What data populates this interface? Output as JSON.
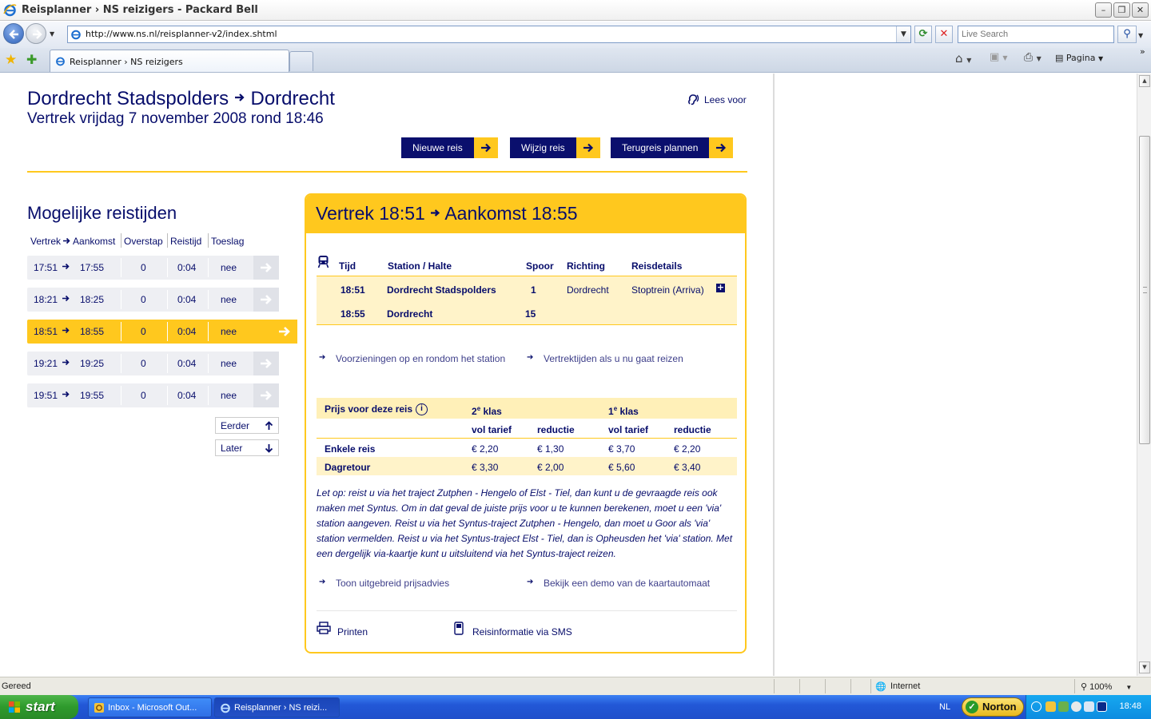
{
  "window": {
    "title": "Reisplanner › NS reizigers - Packard Bell",
    "minimize": "–",
    "maximize": "❐",
    "close": "✕"
  },
  "address": {
    "url": "http://www.ns.nl/reisplanner-v2/index.shtml",
    "search_placeholder": "Live Search"
  },
  "tabs": [
    {
      "title": "Reisplanner › NS reizigers"
    }
  ],
  "toolbar": {
    "page_label": "Pagina"
  },
  "page": {
    "route_from": "Dordrecht Stadspolders",
    "route_to": "Dordrecht",
    "date_line": "Vertrek vrijdag 7 november 2008 rond 18:46",
    "read_aloud": "Lees voor",
    "buttons": {
      "new": "Nieuwe reis",
      "edit": "Wijzig reis",
      "return": "Terugreis plannen"
    },
    "options_title": "Mogelijke reistijden",
    "columns": {
      "depart_arrive": "Vertrek",
      "arrive": "Aankomst",
      "transfers": "Overstap",
      "duration": "Reistijd",
      "surcharge": "Toeslag"
    },
    "trips": [
      {
        "dep": "17:51",
        "arr": "17:55",
        "transfers": "0",
        "duration": "0:04",
        "surcharge": "nee",
        "selected": false
      },
      {
        "dep": "18:21",
        "arr": "18:25",
        "transfers": "0",
        "duration": "0:04",
        "surcharge": "nee",
        "selected": false
      },
      {
        "dep": "18:51",
        "arr": "18:55",
        "transfers": "0",
        "duration": "0:04",
        "surcharge": "nee",
        "selected": true
      },
      {
        "dep": "19:21",
        "arr": "19:25",
        "transfers": "0",
        "duration": "0:04",
        "surcharge": "nee",
        "selected": false
      },
      {
        "dep": "19:51",
        "arr": "19:55",
        "transfers": "0",
        "duration": "0:04",
        "surcharge": "nee",
        "selected": false
      }
    ],
    "earlier": "Eerder",
    "later": "Later",
    "detail": {
      "header_dep": "Vertrek 18:51",
      "header_arr": "Aankomst 18:55",
      "cols": {
        "time": "Tijd",
        "station": "Station / Halte",
        "platform": "Spoor",
        "direction": "Richting",
        "details": "Reisdetails"
      },
      "stops": [
        {
          "time": "18:51",
          "station": "Dordrecht Stadspolders",
          "platform": "1",
          "direction": "Dordrecht",
          "details": "Stoptrein (Arriva)"
        },
        {
          "time": "18:55",
          "station": "Dordrecht",
          "platform": "15",
          "direction": "",
          "details": ""
        }
      ],
      "link_facilities": "Voorzieningen op en rondom het station",
      "link_departures": "Vertrektijden als u nu gaat reizen",
      "price": {
        "title": "Prijs voor deze reis",
        "class2_num": "2",
        "class1_num": "1",
        "class_sup": "e",
        "class_word": "klas",
        "full": "vol tarief",
        "reduced": "reductie",
        "rows": [
          {
            "label": "Enkele reis",
            "c2_full": "€ 2,20",
            "c2_red": "€ 1,30",
            "c1_full": "€ 3,70",
            "c1_red": "€ 2,20"
          },
          {
            "label": "Dagretour",
            "c2_full": "€ 3,30",
            "c2_red": "€ 2,00",
            "c1_full": "€ 5,60",
            "c1_red": "€ 3,40"
          }
        ]
      },
      "note": "Let op: reist u via het traject Zutphen - Hengelo of Elst - Tiel, dan kunt u de gevraagde reis ook maken met Syntus. Om in dat geval de juiste prijs voor u te kunnen berekenen, moet u een 'via' station aangeven. Reist u via het Syntus-traject Zutphen - Hengelo, dan moet u Goor als 'via' station vermelden. Reist u via het Syntus-traject Elst - Tiel, dan is Opheusden het 'via' station. Met een dergelijk via-kaartje kunt u uitsluitend via het Syntus-traject reizen.",
      "link_price_advice": "Toon uitgebreid prijsadvies",
      "link_demo": "Bekijk een demo van de kaartautomaat",
      "print": "Printen",
      "sms": "Reisinformatie via SMS"
    }
  },
  "status": {
    "text": "Gereed",
    "zone": "Internet",
    "zoom": "100%"
  },
  "taskbar": {
    "start": "start",
    "items": [
      {
        "title": "Inbox - Microsoft Out..."
      },
      {
        "title": "Reisplanner › NS reizi..."
      }
    ],
    "lang": "NL",
    "norton": "Norton",
    "clock": "18:48"
  },
  "colors": {
    "ns_yellow": "#ffc81e",
    "ns_navy": "#070d6b"
  }
}
